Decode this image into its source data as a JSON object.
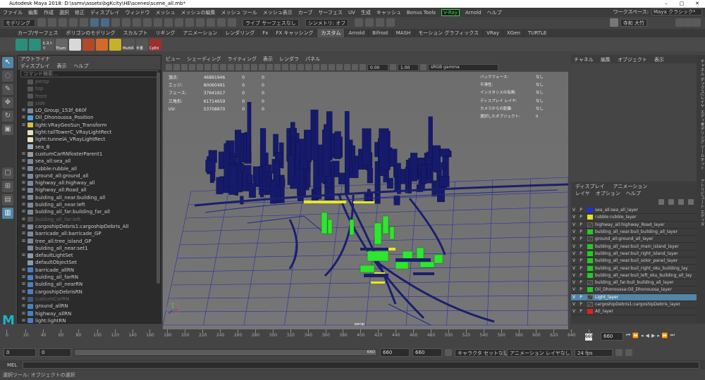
{
  "window": {
    "title": "Autodesk Maya 2018: D:\\ssmv\\assets\\bgKcity\\HE\\scenes\\scene_all.mb*",
    "controls": [
      "–",
      "□",
      "✕"
    ]
  },
  "menubar": {
    "items": [
      "ファイル",
      "編集",
      "作成",
      "選択",
      "修正",
      "ディスプレイ",
      "ウィンドウ",
      "メッシュ",
      "メッシュの編集",
      "メッシュ ツール",
      "メッシュ表示",
      "カーブ",
      "サーフェス",
      "UV",
      "生成",
      "キャッシュ",
      "Bonus Tools",
      "V-Ray",
      "Arnold",
      "ヘルプ"
    ]
  },
  "workspace": {
    "label": "ワークスペース:",
    "value": "Maya クラシック*"
  },
  "statusline": {
    "mode": "モデリング",
    "live_label": "ライブ サーフェスなし",
    "symmetry": "シンメトリ: オフ",
    "user": "寺和 大竹"
  },
  "shelf": {
    "tabs": [
      "カーブ/サーフェス",
      "ポリゴンのモデリング",
      "スカルプト",
      "リギング",
      "アニメーション",
      "レンダリング",
      "Fx",
      "FX キャッシング",
      "カスタム",
      "Arnold",
      "Bifrost",
      "MASH",
      "モーション グラフィックス",
      "VRay",
      "XGen",
      "TURTLE"
    ],
    "active": "カスタム",
    "icons": [
      {
        "label": "",
        "color": "#2a8f7a"
      },
      {
        "label": "",
        "color": "#2a8f7a"
      },
      {
        "label": "ヒストリ",
        "color": "#555"
      },
      {
        "label": "Thum",
        "color": "#666"
      },
      {
        "label": "",
        "color": "#d8d8d8"
      },
      {
        "label": "",
        "color": "#b24a2a"
      },
      {
        "label": "",
        "color": "#d46a2a"
      },
      {
        "label": "",
        "color": "#c8b02a"
      },
      {
        "label": "MultiR",
        "color": "#555"
      },
      {
        "label": "手書",
        "color": "#555"
      },
      {
        "label": "CpEd",
        "color": "#9a3030"
      }
    ]
  },
  "outliner": {
    "title": "アウトライナ",
    "menu": [
      "ディスプレイ",
      "表示",
      "ヘルプ"
    ],
    "search_placeholder": "コマンド検索...",
    "items": [
      {
        "label": "persp",
        "dim": true,
        "exp": "",
        "color": "#555"
      },
      {
        "label": "top",
        "dim": true,
        "exp": "",
        "color": "#555"
      },
      {
        "label": "front",
        "dim": true,
        "exp": "",
        "color": "#555"
      },
      {
        "label": "side",
        "dim": true,
        "exp": "",
        "color": "#555"
      },
      {
        "label": "LO_Group_153f_660f",
        "dim": false,
        "exp": "⊞",
        "color": "#7a8a9a"
      },
      {
        "label": "Oil_Dhonoussa_Position",
        "dim": false,
        "exp": "⊞",
        "color": "#4aa0d8"
      },
      {
        "label": "light:VRayGeoSun_Transform",
        "dim": false,
        "exp": "⊞",
        "color": "#d8c040"
      },
      {
        "label": "light:tallTowerC_VRayLightRect",
        "dim": false,
        "exp": "",
        "color": "#e8e0c0"
      },
      {
        "label": "light:tunnelA_VRayLightRect",
        "dim": false,
        "exp": "",
        "color": "#e8e0c0"
      },
      {
        "label": "sea_B",
        "dim": false,
        "exp": "",
        "color": "#9ab0c8"
      },
      {
        "label": "custumCarRNfosterParent1",
        "dim": false,
        "exp": "⊞",
        "color": "#9a9a9a"
      },
      {
        "label": "sea_all:sea_all",
        "dim": false,
        "exp": "⊞",
        "color": "#7a8a9a"
      },
      {
        "label": "rubble:rubble_all",
        "dim": false,
        "exp": "⊞",
        "color": "#7a8a9a"
      },
      {
        "label": "ground_all:ground_all",
        "dim": false,
        "exp": "⊞",
        "color": "#7a8a9a"
      },
      {
        "label": "highway_all:highway_all",
        "dim": false,
        "exp": "⊞",
        "color": "#7a8a9a"
      },
      {
        "label": "highway_all:Road_all",
        "dim": false,
        "exp": "⊞",
        "color": "#7a8a9a"
      },
      {
        "label": "bulding_all_near:building_all",
        "dim": false,
        "exp": "⊞",
        "color": "#7a8a9a"
      },
      {
        "label": "bulding_all_near:left",
        "dim": false,
        "exp": "⊞",
        "color": "#7a8a9a"
      },
      {
        "label": "bulding_all_far:building_far_all",
        "dim": false,
        "exp": "⊞",
        "color": "#7a8a9a"
      },
      {
        "label": "bulding_all_far:left",
        "dim": true,
        "exp": "⊞",
        "color": "#555"
      },
      {
        "label": "cargoshipDebris1:cargoshipDebris_All",
        "dim": false,
        "exp": "⊞",
        "color": "#7a8a9a"
      },
      {
        "label": "barricade_all:barricade_GP",
        "dim": false,
        "exp": "⊞",
        "color": "#7a8a9a"
      },
      {
        "label": "tree_all:tree_island_GP",
        "dim": false,
        "exp": "⊞",
        "color": "#7a8a9a"
      },
      {
        "label": "bulding_all_near:set1",
        "dim": false,
        "exp": "",
        "color": "#7a8a9a"
      },
      {
        "label": "defaultLightSet",
        "dim": false,
        "exp": "⊞",
        "color": "#8a9aaa"
      },
      {
        "label": "defaultObjectSet",
        "dim": false,
        "exp": "",
        "color": "#8a9aaa"
      },
      {
        "label": "barricade_allRN",
        "dim": false,
        "exp": "⊞",
        "color": "#4a80c0"
      },
      {
        "label": "bulding_all_farRN",
        "dim": false,
        "exp": "⊞",
        "color": "#4a80c0"
      },
      {
        "label": "bulding_all_nearRN",
        "dim": false,
        "exp": "⊞",
        "color": "#4a80c0"
      },
      {
        "label": "cargoshipDebrisRN",
        "dim": false,
        "exp": "⊞",
        "color": "#4a80c0"
      },
      {
        "label": "custumCarRN",
        "dim": true,
        "exp": "⊞",
        "color": "#3a5a80"
      },
      {
        "label": "ground_allRN",
        "dim": false,
        "exp": "⊞",
        "color": "#4a80c0"
      },
      {
        "label": "highway_allRN",
        "dim": false,
        "exp": "⊞",
        "color": "#4a80c0"
      },
      {
        "label": "light:lightRN",
        "dim": false,
        "exp": "⊞",
        "color": "#4a80c0"
      }
    ]
  },
  "viewport": {
    "menu": [
      "ビュー",
      "シェーディング",
      "ライティング",
      "表示",
      "レンダラ",
      "パネル"
    ],
    "exposure": "0.00",
    "gamma": "1.00",
    "colorspace": "sRGB gamma",
    "camera": "persp",
    "hud_left": [
      [
        "頂点:",
        "46891946",
        "0",
        "0"
      ],
      [
        "エッジ:",
        "80060491",
        "0",
        "0"
      ],
      [
        "フェース:",
        "37641617",
        "0",
        "0"
      ],
      [
        "三角形:",
        "61714659",
        "0",
        "0"
      ],
      [
        "UV:",
        "53708870",
        "0",
        "0"
      ]
    ],
    "hud_right": [
      [
        "バックフェース:",
        "なし"
      ],
      [
        "平滑性:",
        "なし"
      ],
      [
        "インスタンスの有無:",
        "なし"
      ],
      [
        "ディスプレイ レイヤ:",
        "なし"
      ],
      [
        "カメラからの距離:",
        "なし"
      ],
      [
        "選択したオブジェクト:",
        "0"
      ]
    ]
  },
  "channelbox": {
    "tabs": [
      "チャネル ボックス/レイヤ エディタ",
      "モデリング ツールキット",
      "アトリビュート エディタ"
    ],
    "menu": [
      "チャネル",
      "編集",
      "オブジェクト",
      "表示"
    ]
  },
  "layers": {
    "tabs": [
      "ディスプレイ",
      "アニメーション"
    ],
    "menu": [
      "レイヤ",
      "オプション",
      "ヘルプ"
    ],
    "items": [
      {
        "v": "V",
        "p": "P",
        "name": "sea_all:sea_all_layer",
        "color": "#1f2fe0",
        "selected": false
      },
      {
        "v": "V",
        "p": "P",
        "name": "rubble:rubble_layer",
        "color": "#e8e020",
        "selected": false
      },
      {
        "v": "V",
        "p": "P",
        "name": "highway_all:highway_Road_layer",
        "color": "none",
        "selected": false
      },
      {
        "v": "V",
        "p": "P",
        "name": "bulding_all_near:buil_building_all_layer",
        "color": "#22cc22",
        "selected": false
      },
      {
        "v": "V",
        "p": "P",
        "name": "ground_all:ground_all_layer",
        "color": "none",
        "selected": false
      },
      {
        "v": "V",
        "p": "P",
        "name": "bulding_all_near:buil_main_island_layer",
        "color": "#22cc22",
        "selected": false
      },
      {
        "v": "V",
        "p": "P",
        "name": "bulding_all_near:buil_right_island_layer",
        "color": "#22cc22",
        "selected": false
      },
      {
        "v": "V",
        "p": "P",
        "name": "bulding_all_near:buil_solor_panel_layer",
        "color": "#22cc22",
        "selected": false
      },
      {
        "v": "V",
        "p": "P",
        "name": "bulding_all_near:buil_right_oku_building_lay",
        "color": "#22cc22",
        "selected": false
      },
      {
        "v": "V",
        "p": "P",
        "name": "bulding_all_near:buil_left_oku_building_all_lay",
        "color": "#22cc22",
        "selected": false
      },
      {
        "v": "V",
        "p": "P",
        "name": "bulding_all_far:buil_building_all_layer",
        "color": "none",
        "selected": false
      },
      {
        "v": "V",
        "p": "P",
        "name": "Oil_Dhonoussa:Oil_Dhonoussa_layer",
        "color": "#22cc22",
        "selected": false
      },
      {
        "v": "V",
        "p": "P",
        "name": "Light_layer",
        "color": "none",
        "selected": true
      },
      {
        "v": "V",
        "p": "P",
        "name": "cargoshipDebris1:cargoshipDebris_layer",
        "color": "none",
        "selected": false
      },
      {
        "v": "V",
        "p": "P",
        "name": "AE_layer",
        "color": "#e02020",
        "selected": false
      }
    ]
  },
  "timeslider": {
    "ticks": [
      "0",
      "20",
      "40",
      "60",
      "80",
      "100",
      "120",
      "140",
      "160",
      "180",
      "200",
      "220",
      "240",
      "260",
      "280",
      "300",
      "320",
      "340",
      "360",
      "380",
      "400",
      "420",
      "440",
      "460",
      "480",
      "500",
      "520",
      "540",
      "560",
      "580",
      "600",
      "620",
      "640",
      "660"
    ],
    "current_frame": "660",
    "marker": "660"
  },
  "range": {
    "start": "0",
    "inner_start": "0",
    "inner_end": "660",
    "end_a": "660",
    "end_b": "660",
    "char_set": "キャラクタ セットなし",
    "anim_layer": "アニメーション レイヤなし",
    "fps": "24 fps"
  },
  "mel": {
    "label": "MEL"
  },
  "helpline": {
    "text": "選択ツール: オブジェクトの選択"
  },
  "logo": {
    "text": "M"
  }
}
